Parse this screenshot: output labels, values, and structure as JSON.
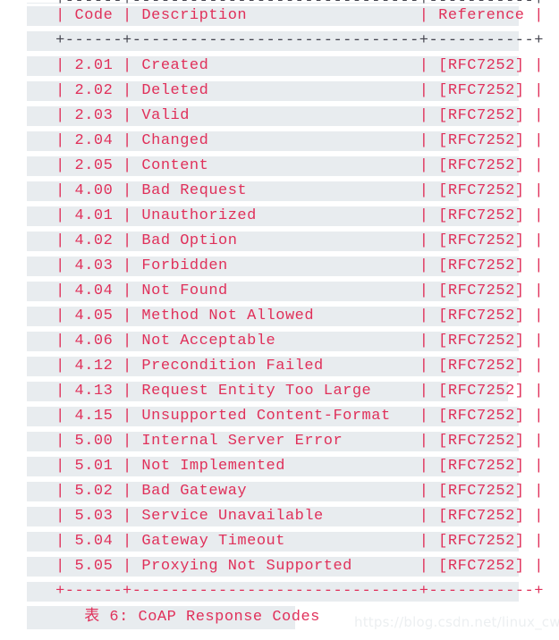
{
  "document": {
    "type": "ascii-art-table",
    "caption_prefix": "表 6:",
    "caption_title": "CoAP Response Codes",
    "caption_full": "      表 6: CoAP Response Codes",
    "colors": {
      "text": "#e0305a",
      "rule_dark": "#45454f",
      "rule_red": "#e0305a",
      "row_highlight": "#e8ecef",
      "page_background": "#ffffff",
      "watermark": "#eceff1"
    }
  },
  "watermark": {
    "text": "https://blog.csdn.net/linux_cwg"
  },
  "table": {
    "columns": [
      "Code",
      "Description",
      "Reference"
    ],
    "header_line": "   | Code | Description                  | Reference |",
    "rule_top_clipped": "   +------+------------------------------+-----------+",
    "rule_header": "   +------+------------------------------+-----------+",
    "rule_bottom": "   +------+------------------------------+-----------+",
    "rows": [
      {
        "code": "2.01",
        "description": "Created",
        "reference": "[RFC7252]",
        "line": "   | 2.01 | Created                      | [RFC7252] |"
      },
      {
        "code": "2.02",
        "description": "Deleted",
        "reference": "[RFC7252]",
        "line": "   | 2.02 | Deleted                      | [RFC7252] |"
      },
      {
        "code": "2.03",
        "description": "Valid",
        "reference": "[RFC7252]",
        "line": "   | 2.03 | Valid                        | [RFC7252] |"
      },
      {
        "code": "2.04",
        "description": "Changed",
        "reference": "[RFC7252]",
        "line": "   | 2.04 | Changed                      | [RFC7252] |"
      },
      {
        "code": "2.05",
        "description": "Content",
        "reference": "[RFC7252]",
        "line": "   | 2.05 | Content                      | [RFC7252] |"
      },
      {
        "code": "4.00",
        "description": "Bad Request",
        "reference": "[RFC7252]",
        "line": "   | 4.00 | Bad Request                  | [RFC7252] |"
      },
      {
        "code": "4.01",
        "description": "Unauthorized",
        "reference": "[RFC7252]",
        "line": "   | 4.01 | Unauthorized                 | [RFC7252] |"
      },
      {
        "code": "4.02",
        "description": "Bad Option",
        "reference": "[RFC7252]",
        "line": "   | 4.02 | Bad Option                   | [RFC7252] |"
      },
      {
        "code": "4.03",
        "description": "Forbidden",
        "reference": "[RFC7252]",
        "line": "   | 4.03 | Forbidden                    | [RFC7252] |"
      },
      {
        "code": "4.04",
        "description": "Not Found",
        "reference": "[RFC7252]",
        "line": "   | 4.04 | Not Found                    | [RFC7252] |"
      },
      {
        "code": "4.05",
        "description": "Method Not Allowed",
        "reference": "[RFC7252]",
        "line": "   | 4.05 | Method Not Allowed           | [RFC7252] |"
      },
      {
        "code": "4.06",
        "description": "Not Acceptable",
        "reference": "[RFC7252]",
        "line": "   | 4.06 | Not Acceptable               | [RFC7252] |"
      },
      {
        "code": "4.12",
        "description": "Precondition Failed",
        "reference": "[RFC7252]",
        "line": "   | 4.12 | Precondition Failed          | [RFC7252] |"
      },
      {
        "code": "4.13",
        "description": "Request Entity Too Large",
        "reference": "[RFC7252]",
        "line": "   | 4.13 | Request Entity Too Large     | [RFC7252] |"
      },
      {
        "code": "4.15",
        "description": "Unsupported Content-Format",
        "reference": "[RFC7252]",
        "line": "   | 4.15 | Unsupported Content-Format   | [RFC7252] |"
      },
      {
        "code": "5.00",
        "description": "Internal Server Error",
        "reference": "[RFC7252]",
        "line": "   | 5.00 | Internal Server Error        | [RFC7252] |"
      },
      {
        "code": "5.01",
        "description": "Not Implemented",
        "reference": "[RFC7252]",
        "line": "   | 5.01 | Not Implemented              | [RFC7252] |"
      },
      {
        "code": "5.02",
        "description": "Bad Gateway",
        "reference": "[RFC7252]",
        "line": "   | 5.02 | Bad Gateway                  | [RFC7252] |"
      },
      {
        "code": "5.03",
        "description": "Service Unavailable",
        "reference": "[RFC7252]",
        "line": "   | 5.03 | Service Unavailable          | [RFC7252] |"
      },
      {
        "code": "5.04",
        "description": "Gateway Timeout",
        "reference": "[RFC7252]",
        "line": "   | 5.04 | Gateway Timeout              | [RFC7252] |"
      },
      {
        "code": "5.05",
        "description": "Proxying Not Supported",
        "reference": "[RFC7252]",
        "line": "   | 5.05 | Proxying Not Supported       | [RFC7252] |"
      }
    ]
  }
}
